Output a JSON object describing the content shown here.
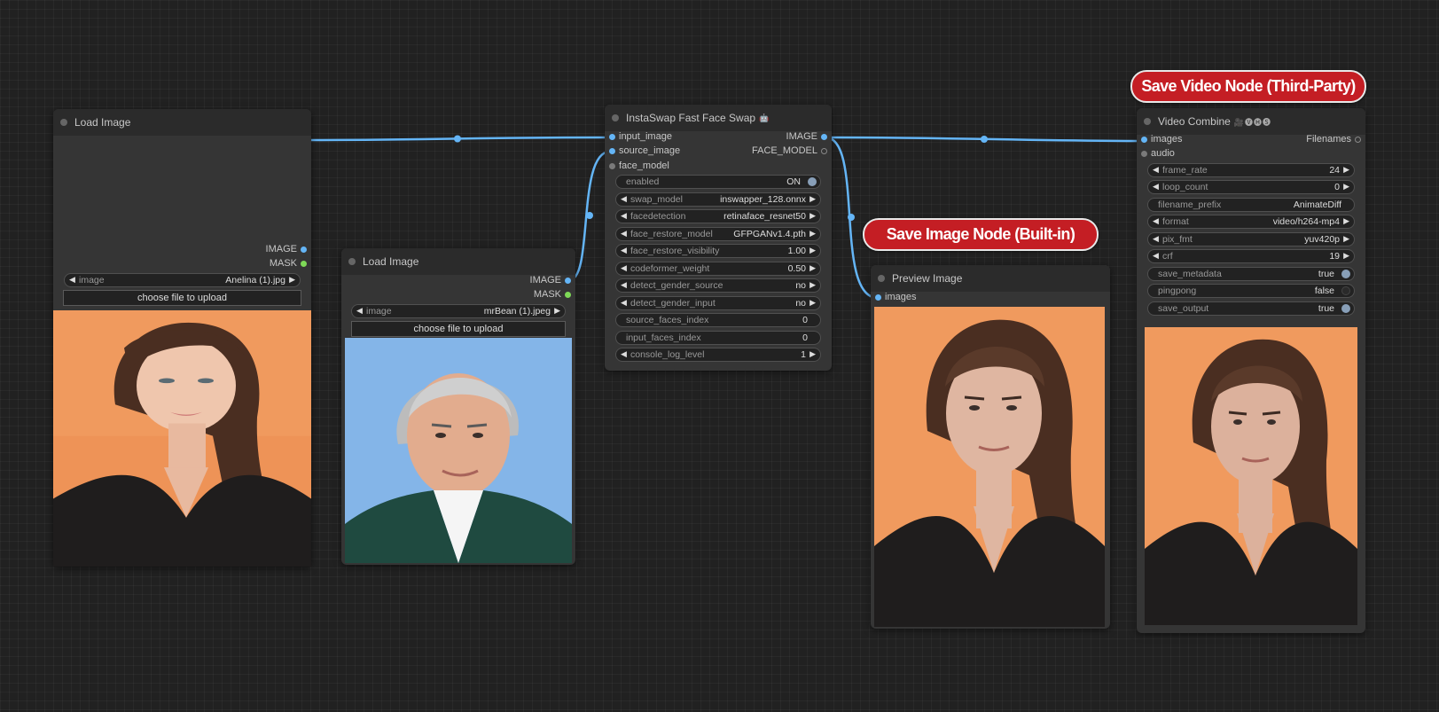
{
  "callouts": {
    "save_image": "Save Image Node (Built-in)",
    "save_video": "Save Video Node (Third-Party)"
  },
  "load_image_1": {
    "title": "Load Image",
    "outputs": [
      "IMAGE",
      "MASK"
    ],
    "image_label": "image",
    "image_value": "Anelina (1).jpg",
    "upload_label": "choose file to upload",
    "preview_alt": "woman-portrait-photo"
  },
  "load_image_2": {
    "title": "Load Image",
    "outputs": [
      "IMAGE",
      "MASK"
    ],
    "image_label": "image",
    "image_value": "mrBean (1).jpeg",
    "upload_label": "choose file to upload",
    "preview_alt": "man-portrait-photo"
  },
  "faceswap": {
    "title": "InstaSwap Fast Face Swap",
    "title_icon": "robot-emoji-icon",
    "inputs": [
      "input_image",
      "source_image",
      "face_model"
    ],
    "outputs": [
      "IMAGE",
      "FACE_MODEL"
    ],
    "widgets": [
      {
        "label": "enabled",
        "value": "ON"
      },
      {
        "label": "swap_model",
        "value": "inswapper_128.onnx"
      },
      {
        "label": "facedetection",
        "value": "retinaface_resnet50"
      },
      {
        "label": "face_restore_model",
        "value": "GFPGANv1.4.pth"
      },
      {
        "label": "face_restore_visibility",
        "value": "1.00"
      },
      {
        "label": "codeformer_weight",
        "value": "0.50"
      },
      {
        "label": "detect_gender_source",
        "value": "no"
      },
      {
        "label": "detect_gender_input",
        "value": "no"
      },
      {
        "label": "source_faces_index",
        "value": "0"
      },
      {
        "label": "input_faces_index",
        "value": "0"
      },
      {
        "label": "console_log_level",
        "value": "1"
      }
    ]
  },
  "preview": {
    "title": "Preview Image",
    "inputs": [
      "images"
    ],
    "preview_alt": "face-swapped-result-photo"
  },
  "video_combine": {
    "title": "Video Combine",
    "title_icons": "🎥🅥🅗🅢",
    "inputs": [
      "images",
      "audio"
    ],
    "outputs": [
      "Filenames"
    ],
    "widgets": [
      {
        "label": "frame_rate",
        "value": "24"
      },
      {
        "label": "loop_count",
        "value": "0"
      },
      {
        "label": "filename_prefix",
        "value": "AnimateDiff"
      },
      {
        "label": "format",
        "value": "video/h264-mp4"
      },
      {
        "label": "pix_fmt",
        "value": "yuv420p"
      },
      {
        "label": "crf",
        "value": "19"
      },
      {
        "label": "save_metadata",
        "value": "true"
      },
      {
        "label": "pingpong",
        "value": "false"
      },
      {
        "label": "save_output",
        "value": "true"
      }
    ],
    "preview_alt": "video-output-preview"
  },
  "colors": {
    "canvas": "#212121",
    "node_body": "#353535",
    "node_title": "#2b2b2b",
    "link_image": "#64b5f6",
    "mask_slot": "#7ed957",
    "callout_red": "#c41e24"
  }
}
